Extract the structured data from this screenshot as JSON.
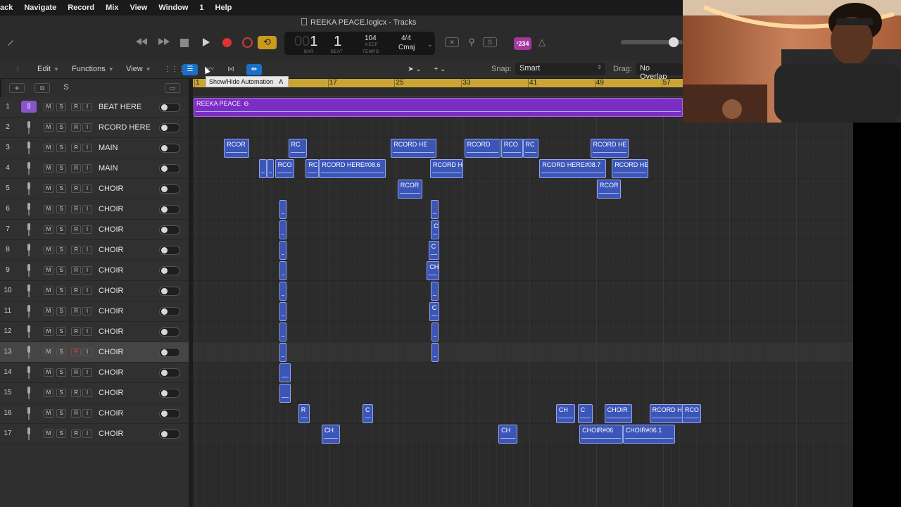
{
  "menubar": [
    "ack",
    "Navigate",
    "Record",
    "Mix",
    "View",
    "Window",
    "1",
    "Help"
  ],
  "window_title": "REEKA PEACE.logicx - Tracks",
  "lcd": {
    "bar_dim": "00",
    "bar": "1",
    "beat": "1",
    "bar_lbl": "BAR",
    "beat_lbl": "BEAT",
    "tempo": "104",
    "keep": "KEEP",
    "tempo_lbl": "TEMPO",
    "sig": "4/4",
    "key": "Cmaj"
  },
  "count_in": "¹234",
  "toolbar": {
    "edit": "Edit",
    "functions": "Functions",
    "view": "View",
    "snap_label": "Snap:",
    "snap_value": "Smart",
    "drag_label": "Drag:",
    "drag_value": "No Overlap"
  },
  "tooltip": {
    "text": "Show/Hide Automation",
    "key": "A"
  },
  "header_buttons": {
    "add": "+",
    "copy": "⧉",
    "s": "S"
  },
  "ruler": [
    "1",
    "9",
    "17",
    "25",
    "33",
    "41",
    "49",
    "57"
  ],
  "track_buttons": [
    "M",
    "S",
    "R",
    "I"
  ],
  "tracks": [
    {
      "num": "1",
      "name": "BEAT HERE",
      "type": "beat"
    },
    {
      "num": "2",
      "name": "RCORD HERE",
      "type": "mic"
    },
    {
      "num": "3",
      "name": "MAIN",
      "type": "mic"
    },
    {
      "num": "4",
      "name": "MAIN",
      "type": "mic"
    },
    {
      "num": "5",
      "name": "CHOIR",
      "type": "mic"
    },
    {
      "num": "6",
      "name": "CHOIR",
      "type": "mic"
    },
    {
      "num": "7",
      "name": "CHOIR",
      "type": "mic"
    },
    {
      "num": "8",
      "name": "CHOIR",
      "type": "mic"
    },
    {
      "num": "9",
      "name": "CHOIR",
      "type": "mic"
    },
    {
      "num": "10",
      "name": "CHOIR",
      "type": "mic"
    },
    {
      "num": "11",
      "name": "CHOIR",
      "type": "mic"
    },
    {
      "num": "12",
      "name": "CHOIR",
      "type": "mic"
    },
    {
      "num": "13",
      "name": "CHOIR",
      "type": "mic",
      "selected": true
    },
    {
      "num": "14",
      "name": "CHOIR",
      "type": "mic"
    },
    {
      "num": "15",
      "name": "CHOIR",
      "type": "mic"
    },
    {
      "num": "16",
      "name": "CHOIR",
      "type": "mic"
    },
    {
      "num": "17",
      "name": "CHOIR",
      "type": "mic"
    }
  ],
  "beat_region": {
    "name": "REEKA PEACE",
    "loop_icon": "loop-icon",
    "color": "#7c2ec4"
  },
  "regions": [
    {
      "track": 3,
      "bar_start": 4.4,
      "bar_len": 3.0,
      "name": "RCOR"
    },
    {
      "track": 3,
      "bar_start": 12.1,
      "bar_len": 2.2,
      "name": "RC"
    },
    {
      "track": 3,
      "bar_start": 24.4,
      "bar_len": 5.5,
      "name": "RCORD HE"
    },
    {
      "track": 3,
      "bar_start": 33.2,
      "bar_len": 4.3,
      "name": "RCORD"
    },
    {
      "track": 3,
      "bar_start": 37.6,
      "bar_len": 2.6,
      "name": "RCO"
    },
    {
      "track": 3,
      "bar_start": 40.2,
      "bar_len": 1.9,
      "name": "RC"
    },
    {
      "track": 3,
      "bar_start": 48.3,
      "bar_len": 4.6,
      "name": "RCORD HE"
    },
    {
      "track": 4,
      "bar_start": 8.6,
      "bar_len": 0.9,
      "name": ""
    },
    {
      "track": 4,
      "bar_start": 9.5,
      "bar_len": 0.9,
      "name": ""
    },
    {
      "track": 4,
      "bar_start": 10.5,
      "bar_len": 2.3,
      "name": "RCO"
    },
    {
      "track": 4,
      "bar_start": 14.2,
      "bar_len": 1.6,
      "name": "RC"
    },
    {
      "track": 4,
      "bar_start": 15.8,
      "bar_len": 8.0,
      "name": "RCORD HERE#08.6"
    },
    {
      "track": 4,
      "bar_start": 29.1,
      "bar_len": 4.0,
      "name": "RCORD H"
    },
    {
      "track": 4,
      "bar_start": 42.2,
      "bar_len": 8.0,
      "name": "RCORD HERE#08.7"
    },
    {
      "track": 4,
      "bar_start": 50.9,
      "bar_len": 4.4,
      "name": "RCORD HE"
    },
    {
      "track": 5,
      "bar_start": 25.2,
      "bar_len": 3.0,
      "name": "RCOR"
    },
    {
      "track": 5,
      "bar_start": 49.1,
      "bar_len": 2.9,
      "name": "RCOR"
    },
    {
      "track": 6,
      "bar_start": 11.0,
      "bar_len": 0.9,
      "name": ""
    },
    {
      "track": 6,
      "bar_start": 29.2,
      "bar_len": 0.9,
      "name": ""
    },
    {
      "track": 7,
      "bar_start": 11.0,
      "bar_len": 0.9,
      "name": ""
    },
    {
      "track": 7,
      "bar_start": 29.2,
      "bar_len": 1.0,
      "name": "C"
    },
    {
      "track": 8,
      "bar_start": 11.0,
      "bar_len": 0.9,
      "name": ""
    },
    {
      "track": 8,
      "bar_start": 28.9,
      "bar_len": 1.3,
      "name": "C"
    },
    {
      "track": 9,
      "bar_start": 11.0,
      "bar_len": 0.9,
      "name": ""
    },
    {
      "track": 9,
      "bar_start": 28.7,
      "bar_len": 1.5,
      "name": "CH"
    },
    {
      "track": 10,
      "bar_start": 11.0,
      "bar_len": 0.9,
      "name": ""
    },
    {
      "track": 10,
      "bar_start": 29.2,
      "bar_len": 0.9,
      "name": ""
    },
    {
      "track": 11,
      "bar_start": 11.0,
      "bar_len": 0.9,
      "name": ""
    },
    {
      "track": 11,
      "bar_start": 29.0,
      "bar_len": 1.2,
      "name": "C"
    },
    {
      "track": 12,
      "bar_start": 11.0,
      "bar_len": 0.9,
      "name": ""
    },
    {
      "track": 12,
      "bar_start": 29.3,
      "bar_len": 0.8,
      "name": ""
    },
    {
      "track": 13,
      "bar_start": 11.0,
      "bar_len": 0.9,
      "name": ""
    },
    {
      "track": 13,
      "bar_start": 29.3,
      "bar_len": 0.8,
      "name": ""
    },
    {
      "track": 14,
      "bar_start": 11.0,
      "bar_len": 1.4,
      "name": ""
    },
    {
      "track": 15,
      "bar_start": 11.0,
      "bar_len": 1.4,
      "name": ""
    },
    {
      "track": 16,
      "bar_start": 13.3,
      "bar_len": 1.4,
      "name": "R"
    },
    {
      "track": 16,
      "bar_start": 21.0,
      "bar_len": 1.3,
      "name": "C"
    },
    {
      "track": 16,
      "bar_start": 44.2,
      "bar_len": 2.3,
      "name": "CH"
    },
    {
      "track": 16,
      "bar_start": 46.8,
      "bar_len": 1.8,
      "name": "C"
    },
    {
      "track": 16,
      "bar_start": 50.0,
      "bar_len": 3.3,
      "name": "CHOIR"
    },
    {
      "track": 16,
      "bar_start": 55.4,
      "bar_len": 4.4,
      "name": "RCORD H"
    },
    {
      "track": 16,
      "bar_start": 59.3,
      "bar_len": 2.3,
      "name": "RCO"
    },
    {
      "track": 17,
      "bar_start": 16.1,
      "bar_len": 2.2,
      "name": "CH"
    },
    {
      "track": 17,
      "bar_start": 37.3,
      "bar_len": 2.3,
      "name": "CH"
    },
    {
      "track": 17,
      "bar_start": 47.0,
      "bar_len": 5.2,
      "name": "CHOIR#06"
    },
    {
      "track": 17,
      "bar_start": 52.2,
      "bar_len": 6.3,
      "name": "CHOIR#06.1"
    }
  ]
}
